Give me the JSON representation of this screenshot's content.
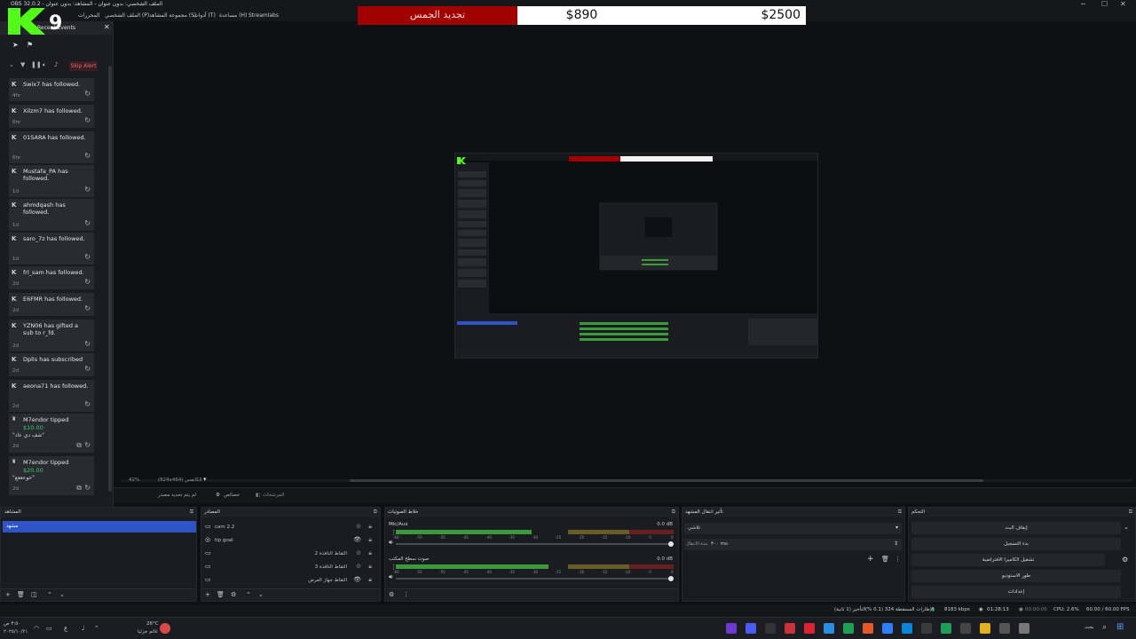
{
  "window": {
    "title": "OBS 32.0.2 - الملف الشخصي: بدون عنوان - المشاهد: بدون عنوان",
    "menu": [
      "Streamlabs",
      "مساعدة (H)",
      "أدوات (T)",
      "مجموعة المشاهد (S)",
      "الملف الشخصي (P)",
      "المشاهد",
      "المحررات",
      "(V)"
    ]
  },
  "goal_bar": {
    "label": "تجديد الجمس",
    "current": "$890",
    "target": "$2500",
    "progress": 0.356,
    "fill_color": "#a10000"
  },
  "logo": {
    "text": "9"
  },
  "recent_events": {
    "header": "Recent Events",
    "skip_alert": "Skip Alert",
    "events": [
      {
        "name": "Swix7 has followed.",
        "time": "4hr"
      },
      {
        "name": "Xilzm7 has followed.",
        "time": "6hr"
      },
      {
        "name": "01SARA has followed.",
        "time": "6hr"
      },
      {
        "name": "Mustafa_PA has followed.",
        "time": "1d"
      },
      {
        "name": "ahmdqash has followed.",
        "time": "1d"
      },
      {
        "name": "saro_7z has followed.",
        "time": "1d"
      },
      {
        "name": "frl_sam has followed.",
        "time": "2d"
      },
      {
        "name": "E6FMR has followed.",
        "time": "2d"
      },
      {
        "name": "YZN06 has gifted a sub to r_fd.",
        "time": "2d"
      },
      {
        "name": "Dplis has subscribed",
        "time": "2d"
      },
      {
        "name": "aeona71 has followed.",
        "time": "2d"
      }
    ],
    "tips": [
      {
        "name": "M7endor tipped",
        "amount": "$10.00",
        "message": "\"شف دي عاد\"",
        "time": "2d"
      },
      {
        "name": "M7endor tipped",
        "amount": "$20.00",
        "message": "\"حوعععع\"",
        "time": "2d"
      }
    ]
  },
  "canvas": {
    "zoom": "42%",
    "resolution": "(824x464) الكانفس",
    "context_buttons": [
      "لم يتم تحديد مصدر",
      "خصائص",
      "المرشحات"
    ]
  },
  "scenes": {
    "header": "المشاهد",
    "selected": "مشهد"
  },
  "sources": {
    "header": "المصادر",
    "items": [
      {
        "name": "cam 2.2",
        "visible": false
      },
      {
        "name": "tip goal",
        "visible": true
      },
      {
        "name": "التقاط النافذة 2",
        "visible": false
      },
      {
        "name": "التقاط النافذة 3",
        "visible": false
      },
      {
        "name": "التقاط جهاز العرض",
        "visible": true
      }
    ]
  },
  "audio_mixer": {
    "header": "خلاط الصوتيات",
    "channels": [
      {
        "name": "Mic/Aux",
        "db": "0.0 dB",
        "level": 0.49
      },
      {
        "name": "صوت سطح المكتب",
        "db": "0.0 dB",
        "level": 0.55
      }
    ],
    "ticks": [
      "-60",
      "-55",
      "-50",
      "-45",
      "-40",
      "-35",
      "-30",
      "-25",
      "-20",
      "-15",
      "-10",
      "-5",
      "0"
    ]
  },
  "transitions": {
    "header": "تأثير انتقال المشهد",
    "selected": "تلاشي",
    "duration_label": "مدة الانتقال",
    "duration": "٣٠٠ ms"
  },
  "controls": {
    "header": "التحكم",
    "buttons": [
      "إيقاف البث",
      "بدء التسجيل",
      "تشغيل الكاميرا الافتراضية",
      "طور الاستوديو",
      "إعدادات"
    ]
  },
  "status": {
    "frames": "الإطارات المسقطة 324 (0.1 %)",
    "delay": "التأخير (1 ثانية)",
    "kbps": "8183 kbps",
    "stream_time": "01:28:13",
    "rec_time": "00:00:00",
    "cpu": "CPU: 2.6%",
    "fps": "60.00 / 60.00 FPS"
  },
  "taskbar": {
    "weather_temp": "26°C",
    "weather_desc": "غائم جزئيا",
    "search": "بحث",
    "clock_time": "٣:٥٠ ص",
    "clock_date": "٢٠٢٥/١٠/٢١"
  },
  "colors": {
    "accent_blue": "#2f54c8",
    "goal_red": "#a10000",
    "meter_green": "#3b9a3a"
  }
}
